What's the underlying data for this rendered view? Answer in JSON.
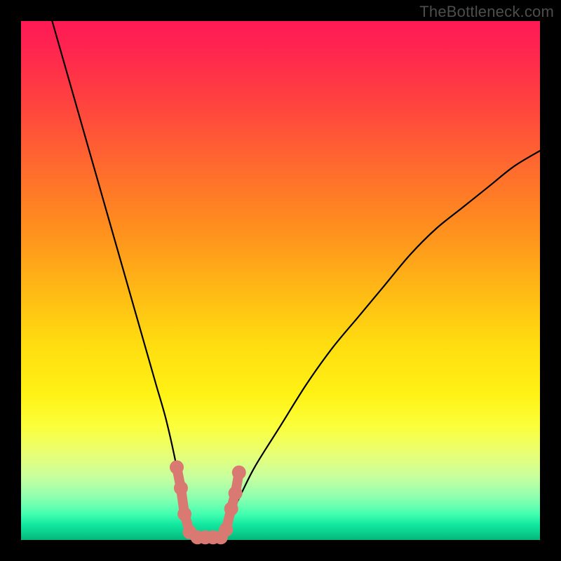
{
  "watermark": "TheBottleneck.com",
  "chart_data": {
    "type": "line",
    "title": "",
    "xlabel": "",
    "ylabel": "",
    "xlim": [
      0,
      100
    ],
    "ylim": [
      0,
      100
    ],
    "series": [
      {
        "name": "bottleneck-curve",
        "x": [
          6,
          8,
          10,
          12,
          14,
          16,
          18,
          20,
          22,
          24,
          26,
          28,
          30,
          31,
          32,
          34,
          36,
          38,
          40,
          42,
          45,
          50,
          55,
          60,
          65,
          70,
          75,
          80,
          85,
          90,
          95,
          100
        ],
        "y": [
          100,
          93,
          86,
          79,
          72,
          65,
          58,
          51,
          44,
          37,
          30,
          23,
          14,
          8,
          4,
          0,
          0,
          0,
          4,
          8,
          14,
          22,
          30,
          37,
          43,
          49,
          55,
          60,
          64,
          68,
          72,
          75
        ]
      }
    ],
    "markers": {
      "name": "highlight-cluster",
      "color": "#d97a72",
      "points": [
        {
          "x": 30.0,
          "y": 14
        },
        {
          "x": 30.8,
          "y": 10
        },
        {
          "x": 31.5,
          "y": 5
        },
        {
          "x": 32.5,
          "y": 1.5
        },
        {
          "x": 34.0,
          "y": 0.5
        },
        {
          "x": 35.5,
          "y": 0.5
        },
        {
          "x": 37.0,
          "y": 0.5
        },
        {
          "x": 38.5,
          "y": 0.5
        },
        {
          "x": 39.5,
          "y": 2
        },
        {
          "x": 40.5,
          "y": 6
        },
        {
          "x": 41.3,
          "y": 9
        },
        {
          "x": 42.0,
          "y": 13
        }
      ]
    }
  }
}
